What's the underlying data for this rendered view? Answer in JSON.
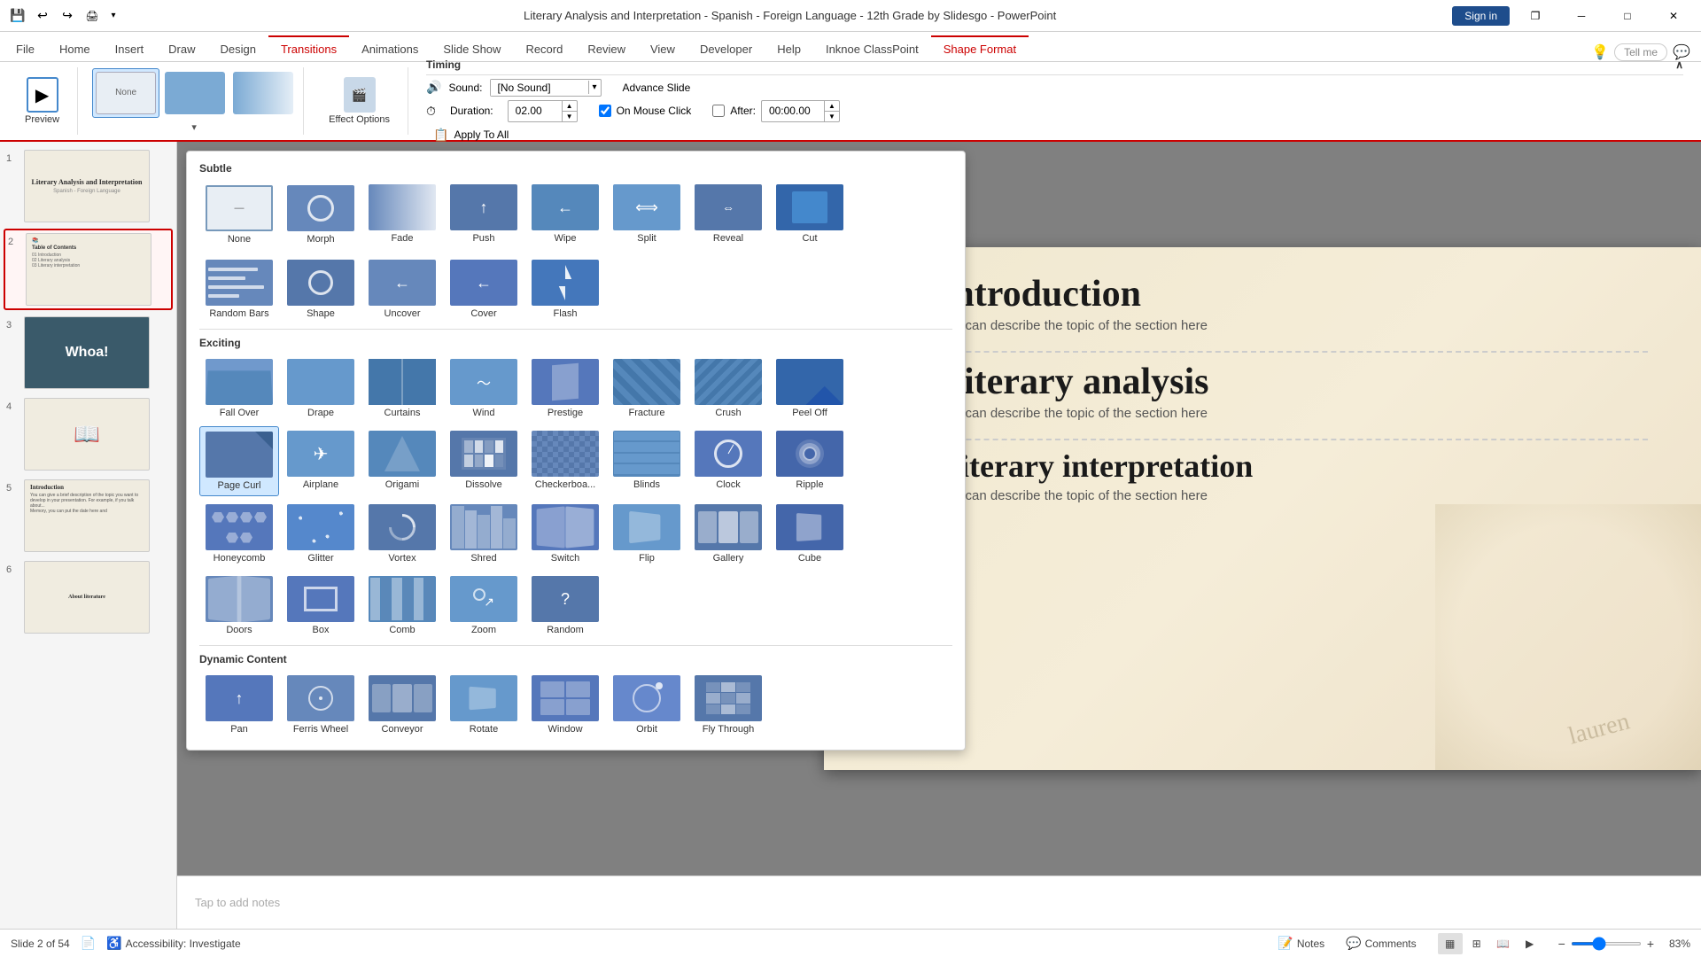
{
  "app": {
    "title": "Literary Analysis and Interpretation - Spanish - Foreign Language - 12th Grade by Slidesgo  -  PowerPoint",
    "sign_in_label": "Sign in"
  },
  "window_controls": {
    "minimize": "─",
    "restore": "❐",
    "close": "✕"
  },
  "tabs": {
    "file": "File",
    "home": "Home",
    "insert": "Insert",
    "draw": "Draw",
    "design": "Design",
    "transitions": "Transitions",
    "animations": "Animations",
    "slide_show": "Slide Show",
    "record": "Record",
    "review": "Review",
    "view": "View",
    "developer": "Developer",
    "help": "Help",
    "inknoe": "Inknoe ClassPoint",
    "shape_format": "Shape Format",
    "tell_me": "Tell me"
  },
  "ribbon": {
    "preview_label": "Preview",
    "effect_options_label": "Effect Options",
    "effect_icon": "🎬"
  },
  "timing": {
    "title": "Timing",
    "sound_label": "Sound:",
    "sound_value": "[No Sound]",
    "duration_label": "Duration:",
    "duration_value": "02.00",
    "advance_slide_label": "Advance Slide",
    "on_mouse_click_label": "On Mouse Click",
    "on_mouse_click_checked": true,
    "after_label": "After:",
    "after_value": "00:00.00",
    "apply_to_all_label": "Apply To All",
    "collapse_icon": "∧"
  },
  "transitions_panel": {
    "subtle_label": "Subtle",
    "exciting_label": "Exciting",
    "dynamic_label": "Dynamic Content",
    "subtle_items": [
      {
        "label": "None",
        "selected": false
      },
      {
        "label": "Morph",
        "selected": false
      },
      {
        "label": "Fade",
        "selected": false
      },
      {
        "label": "Push",
        "selected": false
      },
      {
        "label": "Wipe",
        "selected": false
      },
      {
        "label": "Split",
        "selected": false
      },
      {
        "label": "Reveal",
        "selected": false
      },
      {
        "label": "Cut",
        "selected": false
      },
      {
        "label": "Random Bars",
        "selected": false
      },
      {
        "label": "Shape",
        "selected": false
      },
      {
        "label": "Uncover",
        "selected": false
      },
      {
        "label": "Cover",
        "selected": false
      },
      {
        "label": "Flash",
        "selected": false
      }
    ],
    "exciting_items": [
      {
        "label": "Fall Over",
        "selected": false
      },
      {
        "label": "Drape",
        "selected": false
      },
      {
        "label": "Curtains",
        "selected": false
      },
      {
        "label": "Wind",
        "selected": false
      },
      {
        "label": "Prestige",
        "selected": false
      },
      {
        "label": "Fracture",
        "selected": false
      },
      {
        "label": "Crush",
        "selected": false
      },
      {
        "label": "Peel Off",
        "selected": false
      },
      {
        "label": "Page Curl",
        "selected": true
      },
      {
        "label": "Airplane",
        "selected": false
      },
      {
        "label": "Origami",
        "selected": false
      },
      {
        "label": "Dissolve",
        "selected": false
      },
      {
        "label": "Checkerboard...",
        "selected": false
      },
      {
        "label": "Blinds",
        "selected": false
      },
      {
        "label": "Clock",
        "selected": false
      },
      {
        "label": "Ripple",
        "selected": false
      },
      {
        "label": "Honeycomb",
        "selected": false
      },
      {
        "label": "Glitter",
        "selected": false
      },
      {
        "label": "Vortex",
        "selected": false
      },
      {
        "label": "Shred",
        "selected": false
      },
      {
        "label": "Switch",
        "selected": false
      },
      {
        "label": "Flip",
        "selected": false
      },
      {
        "label": "Gallery",
        "selected": false
      },
      {
        "label": "Cube",
        "selected": false
      },
      {
        "label": "Doors",
        "selected": false
      },
      {
        "label": "Box",
        "selected": false
      },
      {
        "label": "Comb",
        "selected": false
      },
      {
        "label": "Zoom",
        "selected": false
      },
      {
        "label": "Random",
        "selected": false
      }
    ],
    "dynamic_items": [
      {
        "label": "Pan",
        "selected": false
      },
      {
        "label": "Ferris Wheel",
        "selected": false
      },
      {
        "label": "Conveyor",
        "selected": false
      },
      {
        "label": "Rotate",
        "selected": false
      },
      {
        "label": "Window",
        "selected": false
      },
      {
        "label": "Orbit",
        "selected": false
      },
      {
        "label": "Fly Through",
        "selected": false
      }
    ]
  },
  "slides": [
    {
      "num": "1",
      "label": "Literary Analysis and Interpretation"
    },
    {
      "num": "2",
      "label": "Table of contents",
      "active": true
    },
    {
      "num": "3",
      "label": "Whoa!"
    },
    {
      "num": "4",
      "label": ""
    },
    {
      "num": "5",
      "label": "Introduction"
    },
    {
      "num": "6",
      "label": "About literature"
    }
  ],
  "slide_content": {
    "sections": [
      {
        "num": "01",
        "title": "Introduction",
        "desc": "You can describe the topic of the section here"
      },
      {
        "num": "02",
        "title": "Literary analysis",
        "desc": "You can describe the topic of the section here"
      },
      {
        "num": "03",
        "title": "Literary interpretation",
        "desc": "You can describe the topic of the section here"
      }
    ]
  },
  "status_bar": {
    "slide_info": "Slide 2 of 54",
    "accessibility": "Accessibility: Investigate",
    "notes_label": "Notes",
    "comments_label": "Comments",
    "zoom_level": "83%"
  },
  "notes_placeholder": "Tap to add notes"
}
